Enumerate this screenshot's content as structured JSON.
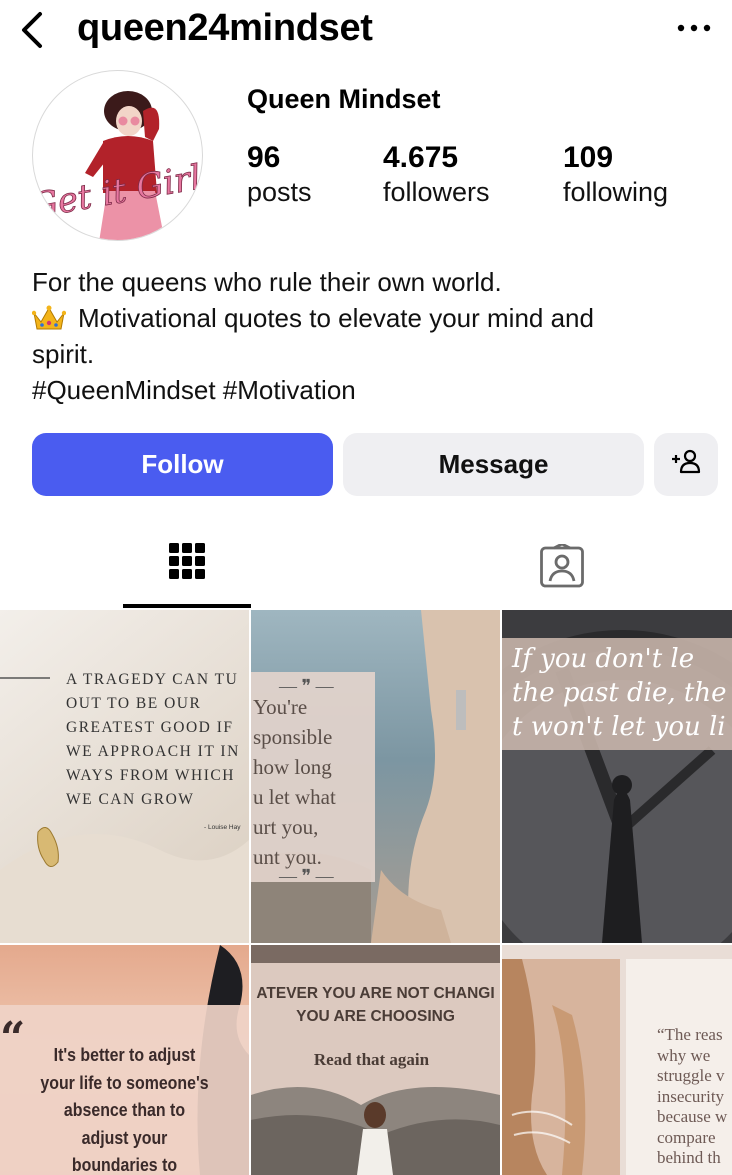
{
  "header": {
    "username": "queen24mindset"
  },
  "profile": {
    "display_name": "Queen Mindset",
    "avatar_text": "Get it Girl",
    "stats": {
      "posts_count": "96",
      "posts_label": "posts",
      "followers_count": "4.675",
      "followers_label": "followers",
      "following_count": "109",
      "following_label": "following"
    }
  },
  "bio": {
    "line1": "For the queens who rule their own world.",
    "line2": "Motivational quotes to elevate your mind and",
    "line3": "spirit.",
    "line4": "#QueenMindset #Motivation"
  },
  "actions": {
    "follow_label": "Follow",
    "message_label": "Message"
  },
  "tabs": {
    "active": "grid"
  },
  "posts": [
    {
      "lines": [
        "A TRAGEDY CAN TU",
        "OUT TO BE OUR",
        "GREATEST GOOD IF",
        "WE APPROACH IT IN",
        "WAYS FROM WHICH",
        "WE CAN GROW"
      ],
      "author": "- Louise Hay"
    },
    {
      "lines": [
        "You're",
        "sponsible",
        "how long",
        "u let what",
        "urt you,",
        "unt you."
      ]
    },
    {
      "lines": [
        "If you don't le",
        "the past die, the",
        "t won't let you li"
      ]
    },
    {
      "lines": [
        "It's better to adjust",
        "your life to someone's",
        "absence than to",
        "adjust your",
        "boundaries to"
      ]
    },
    {
      "lines": [
        "ATEVER YOU ARE NOT CHANGI",
        "YOU ARE CHOOSING"
      ],
      "subline": "Read that again"
    },
    {
      "lines": [
        "“The reas",
        "why we",
        "struggle v",
        "insecurity",
        "because w",
        "compare",
        "behind th"
      ]
    }
  ],
  "colors": {
    "follow_button": "#4a5cf0",
    "secondary_button": "#efeff2"
  }
}
